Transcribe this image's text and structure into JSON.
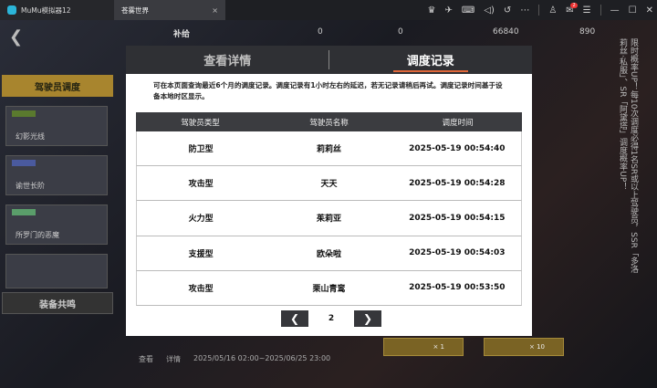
{
  "titlebar": {
    "tabs": [
      {
        "label": "MuMu模拟器12"
      },
      {
        "label": "苍雾世界",
        "close": "×"
      }
    ],
    "notification_count": "2"
  },
  "game": {
    "resource_1": "0",
    "resource_2": "0",
    "resource_3": "66840",
    "resource_4": "890",
    "supply_label": "补给",
    "sidebar_title": "驾驶员调度",
    "cards": [
      "幻影光线",
      "谕世长阶",
      "所罗门的恶魔"
    ],
    "resonance_label": "装备共鸣",
    "vertical_text": "限时概率UP！每10次调度必得1名SR或以上驾驶员，SSR「多洛莉丝·私服」、SR「阿黛塔」调度概率UP！",
    "bottom_view": "查看",
    "bottom_detail": "详情",
    "bottom_dates": "2025/05/16 02:00~2025/06/25 23:00",
    "cost_1": "× 1",
    "cost_10": "× 10"
  },
  "modal": {
    "tabs": [
      {
        "label": "查看详情",
        "active": false
      },
      {
        "label": "调度记录",
        "active": true
      }
    ],
    "notice": "可在本页面查询最近6个月的调度记录。调度记录有1小时左右的延迟，若无记录请稍后再试。调度记录时间基于设备本地时区显示。",
    "table": {
      "headers": [
        "驾驶员类型",
        "驾驶员名称",
        "调度时间"
      ],
      "rows": [
        [
          "防卫型",
          "莉莉丝",
          "2025-05-19 00:54:40"
        ],
        [
          "攻击型",
          "天天",
          "2025-05-19 00:54:28"
        ],
        [
          "火力型",
          "茱莉亚",
          "2025-05-19 00:54:15"
        ],
        [
          "支援型",
          "欧朵啦",
          "2025-05-19 00:54:03"
        ],
        [
          "攻击型",
          "栗山青鸾",
          "2025-05-19 00:53:50"
        ]
      ]
    },
    "pager": {
      "page": "2",
      "prev": "❮",
      "next": "❯"
    }
  }
}
